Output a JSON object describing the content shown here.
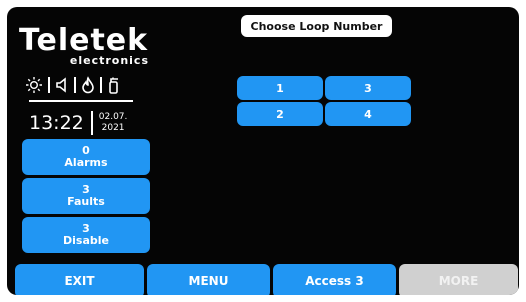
{
  "logo": {
    "brand": "Teletek",
    "subtitle": "electronics"
  },
  "status": {
    "time": "13:22",
    "date_day_month": "02.07.",
    "date_year": "2021"
  },
  "title": "Choose Loop Number",
  "loops": [
    "1",
    "3",
    "2",
    "4"
  ],
  "side": {
    "alarms": {
      "count": "0",
      "label": "Alarms"
    },
    "faults": {
      "count": "3",
      "label": "Faults"
    },
    "disable": {
      "count": "3",
      "label": "Disable"
    }
  },
  "bottom": {
    "exit": "EXIT",
    "menu": "MENU",
    "access": "Access 3",
    "more": "MORE"
  },
  "colors": {
    "button": "#2196f3",
    "background": "#050505",
    "disabled": "#d0d0d0"
  }
}
